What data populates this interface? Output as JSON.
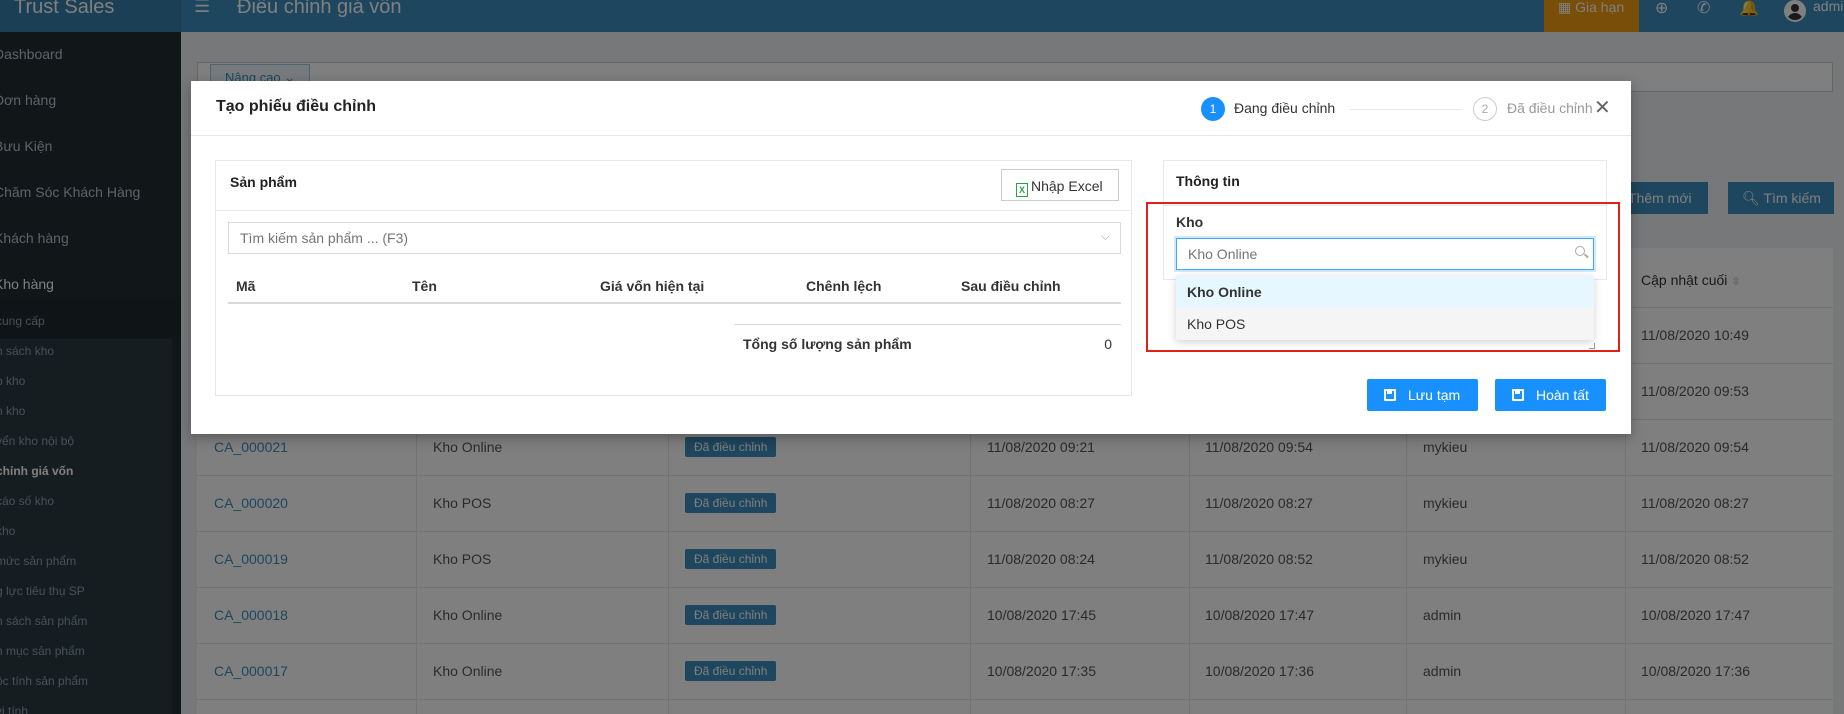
{
  "header": {
    "brand": "Trust Sales",
    "page_title": "Điều chỉnh giá vốn",
    "renew_label": "Gia hạn",
    "user": "admin"
  },
  "sidebar": {
    "items": [
      "Dashboard",
      "Đơn hàng",
      "Bưu Kiện",
      "Chăm Sóc Khách Hàng",
      "Khách hàng",
      "Kho hàng"
    ],
    "sub_items": [
      "cung cấp",
      "h sách kho",
      "p kho",
      "n kho",
      "yển kho nội bộ",
      "chỉnh giá vốn",
      "cáo số kho",
      "kho",
      "mức sản phẩm",
      "g lực tiêu thụ SP",
      "h sách sản phẩm",
      "h mục sản phẩm",
      "ộc tính sản phẩm",
      "vị tính"
    ]
  },
  "main": {
    "advanced_label": "Nâng cao",
    "add_label": "Thêm mới",
    "search_label": "Tìm kiếm",
    "last_update_header": "Cập nhật cuối",
    "rows": [
      {
        "code": "",
        "warehouse": "",
        "status": "",
        "created": "",
        "updated": "",
        "user": "",
        "last": "11/08/2020 10:49"
      },
      {
        "code": "",
        "warehouse": "",
        "status": "",
        "created": "",
        "updated": "",
        "user": "",
        "last": "11/08/2020 09:53"
      },
      {
        "code": "CA_000021",
        "warehouse": "Kho Online",
        "status": "Đã điều chỉnh",
        "created": "11/08/2020 09:21",
        "updated": "11/08/2020 09:54",
        "user": "mykieu",
        "last": "11/08/2020 09:54"
      },
      {
        "code": "CA_000020",
        "warehouse": "Kho POS",
        "status": "Đã điều chỉnh",
        "created": "11/08/2020 08:27",
        "updated": "11/08/2020 08:27",
        "user": "mykieu",
        "last": "11/08/2020 08:27"
      },
      {
        "code": "CA_000019",
        "warehouse": "Kho POS",
        "status": "Đã điều chỉnh",
        "created": "11/08/2020 08:24",
        "updated": "11/08/2020 08:52",
        "user": "mykieu",
        "last": "11/08/2020 08:52"
      },
      {
        "code": "CA_000018",
        "warehouse": "Kho Online",
        "status": "Đã điều chỉnh",
        "created": "10/08/2020 17:45",
        "updated": "10/08/2020 17:47",
        "user": "admin",
        "last": "10/08/2020 17:47"
      },
      {
        "code": "CA_000017",
        "warehouse": "Kho Online",
        "status": "Đã điều chỉnh",
        "created": "10/08/2020 17:35",
        "updated": "10/08/2020 17:36",
        "user": "admin",
        "last": "10/08/2020 17:36"
      }
    ]
  },
  "modal": {
    "title": "Tạo phiếu điều chỉnh",
    "steps": [
      {
        "number": "1",
        "label": "Đang điều chỉnh"
      },
      {
        "number": "2",
        "label": "Đã điều chỉnh"
      }
    ],
    "products": {
      "title": "Sản phẩm",
      "import_label": "Nhập Excel",
      "search_placeholder": "Tìm kiếm sản phẩm ... (F3)",
      "columns": [
        "Mã",
        "Tên",
        "Giá vốn hiện tại",
        "Chênh lệch",
        "Sau điều chỉnh"
      ],
      "total_label": "Tổng số lượng sản phẩm",
      "total_value": "0"
    },
    "info": {
      "title": "Thông tin",
      "warehouse_label": "Kho",
      "warehouse_placeholder": "Kho Online",
      "options": [
        "Kho Online",
        "Kho POS"
      ]
    },
    "save_draft_label": "Lưu tạm",
    "finish_label": "Hoàn tất"
  },
  "colors": {
    "header": "#3c8dbc",
    "sidebar": "#222d32",
    "primary": "#1890ff",
    "highlight": "#e0201b",
    "renew": "#f39c12"
  }
}
